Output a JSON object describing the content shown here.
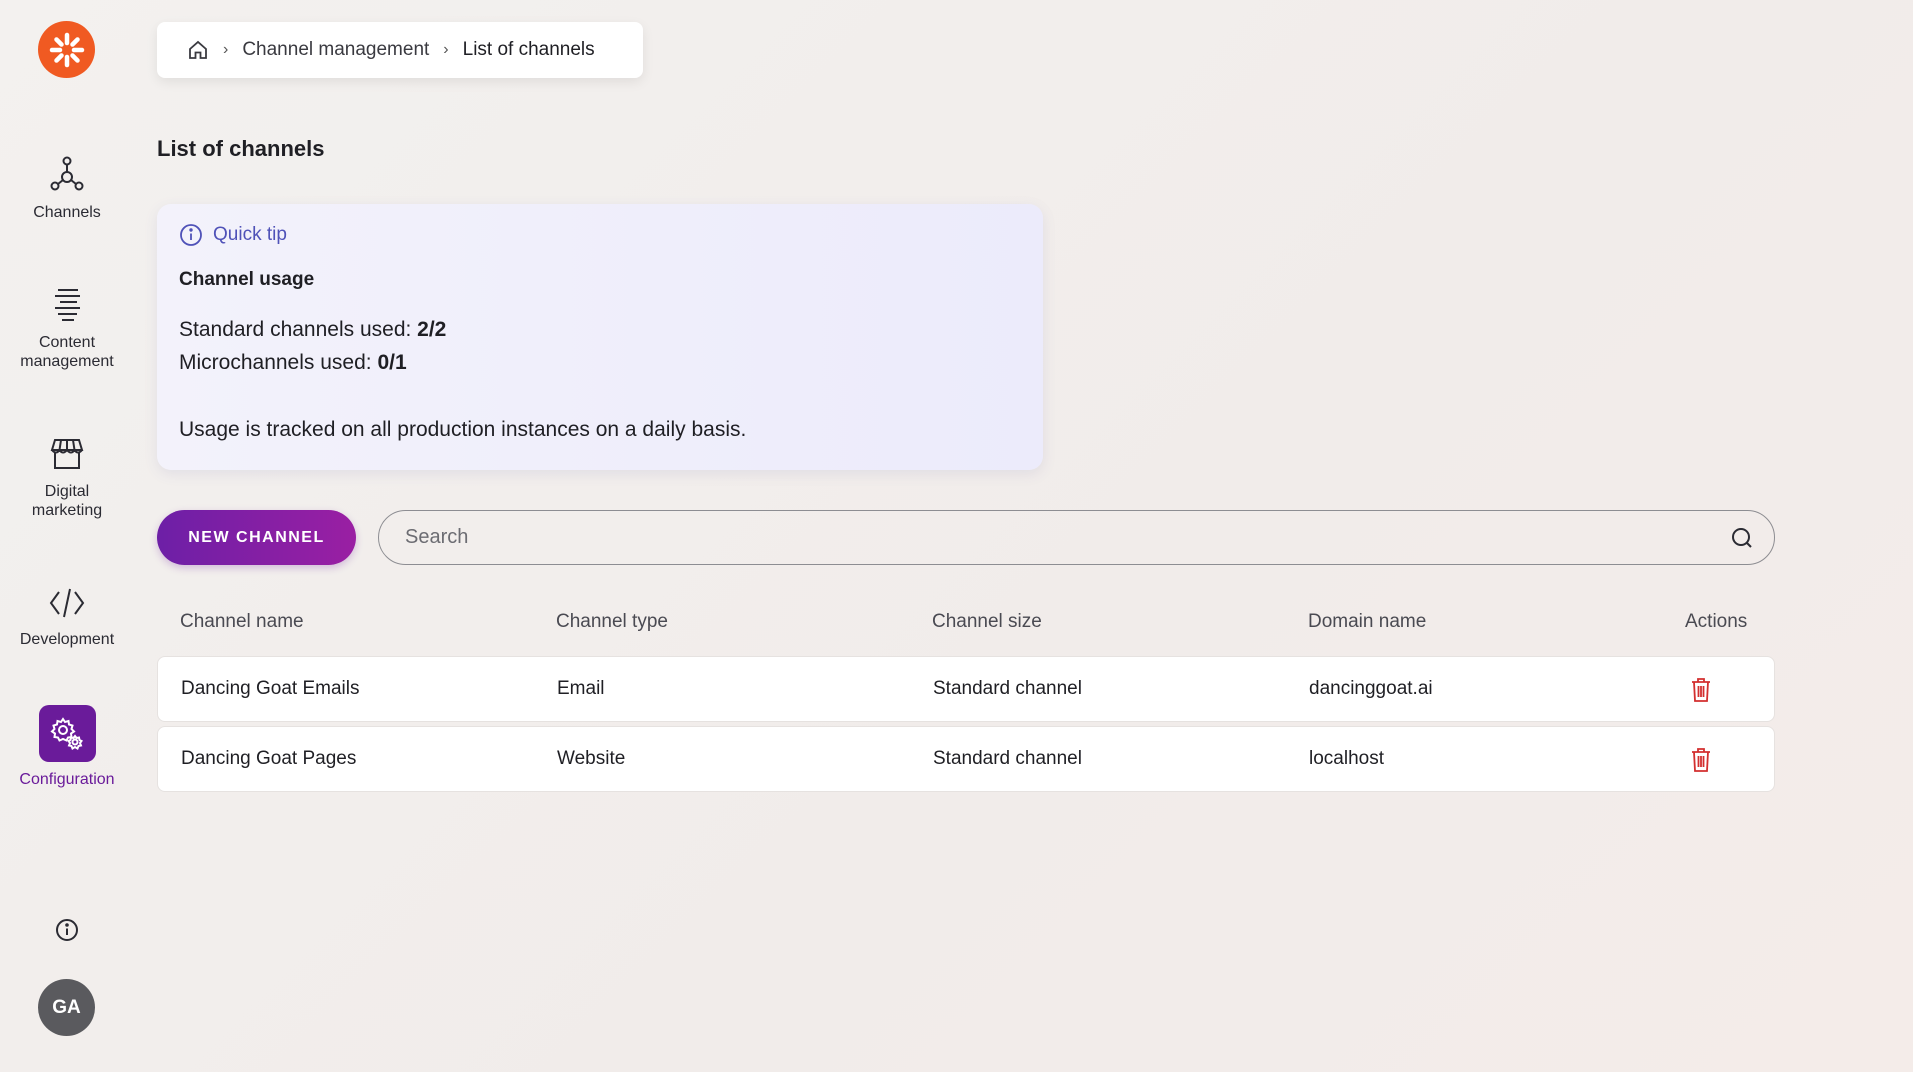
{
  "sidebar": {
    "items": [
      {
        "label": "Channels",
        "icon": "channels-icon"
      },
      {
        "label": "Content\nmanagement",
        "icon": "content-icon"
      },
      {
        "label": "Digital\nmarketing",
        "icon": "store-icon"
      },
      {
        "label": "Development",
        "icon": "code-icon"
      },
      {
        "label": "Configuration",
        "icon": "gear-icon",
        "active": true
      }
    ],
    "avatar": "GA"
  },
  "breadcrumb": {
    "items": [
      "Channel management",
      "List of channels"
    ]
  },
  "page": {
    "title": "List of channels"
  },
  "tip": {
    "header": "Quick tip",
    "title": "Channel usage",
    "standard_label": "Standard channels used: ",
    "standard_value": "2/2",
    "micro_label": "Microchannels used: ",
    "micro_value": "0/1",
    "note": "Usage is tracked on all production instances on a daily basis."
  },
  "toolbar": {
    "new_label": "NEW CHANNEL",
    "search_placeholder": "Search"
  },
  "table": {
    "columns": [
      "Channel name",
      "Channel type",
      "Channel size",
      "Domain name",
      "Actions"
    ],
    "rows": [
      [
        "Dancing Goat Emails",
        "Email",
        "Standard channel",
        "dancinggoat.ai"
      ],
      [
        "Dancing Goat Pages",
        "Website",
        "Standard channel",
        "localhost"
      ]
    ]
  },
  "colors": {
    "accent": "#6a1b9a",
    "logo": "#f05a22",
    "danger": "#d32f2f",
    "tip_link": "#4f52b8"
  }
}
